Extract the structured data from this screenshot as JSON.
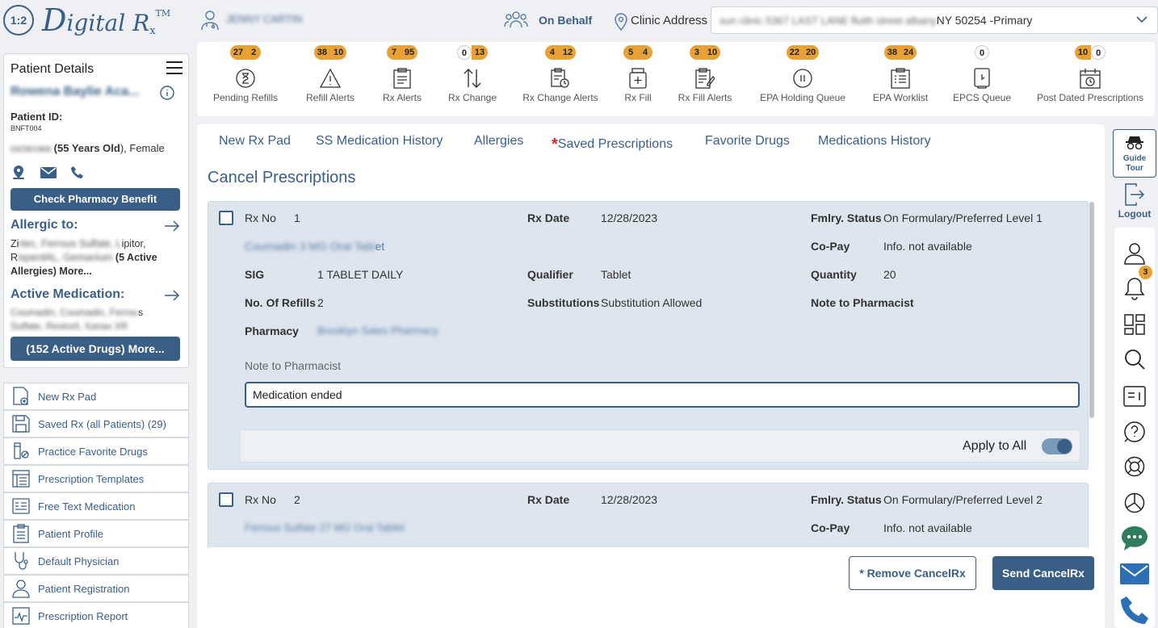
{
  "app": {
    "logo_badge": "1:2",
    "logo_d": "D",
    "logo_rest": "igital R",
    "logo_x": "x",
    "logo_tm": "TM"
  },
  "header": {
    "user_name": "JENNY CARTIN",
    "on_behalf": "On Behalf",
    "clinic_label": "Clinic Address",
    "clinic_value_blurred": "sun clinic 5367 LAST LANE fluith street albany",
    "clinic_value_suffix": " NY 50254 -Primary"
  },
  "patient": {
    "section_title": "Patient Details",
    "name": "Rowena Baylie Aca...",
    "id_label": "Patient ID:",
    "id_value": "BNFT004",
    "dob_blurred": "03/28/1968",
    "age": " (55 Years Old",
    "gender": "), Female",
    "check_benefit": "Check Pharmacy Benefit",
    "allergic_title": "Allergic to:",
    "allergy_line1_a": "Zi",
    "allergy_line1_blur": "rtec, Ferrous Sulfate, L",
    "allergy_line1_b": "ipitor,",
    "allergy_line2_a": "R",
    "allergy_line2_blur": "isperdAL, Gemanium",
    "allergy_count": " (5 Active",
    "allergy_line3": "Allergies) More...",
    "active_med_title": "Active Medication:",
    "med_line1_blur": "Coumadin, Coumadin, Ferrou",
    "med_line1_b": "s",
    "med_line2_blur": "Sulfate, Restoril, Xanax XR",
    "active_drugs_btn": "(152 Active Drugs) More..."
  },
  "left_menu": [
    {
      "label": "New Rx Pad",
      "icon": "new-rx-pad-icon"
    },
    {
      "label": "Saved Rx (all Patients) (29)",
      "icon": "save-icon"
    },
    {
      "label": "Practice Favorite Drugs",
      "icon": "pill-bottle-icon"
    },
    {
      "label": "Prescription Templates",
      "icon": "template-icon"
    },
    {
      "label": "Free Text Medication",
      "icon": "free-text-icon"
    },
    {
      "label": "Patient Profile",
      "icon": "profile-clipboard-icon"
    },
    {
      "label": "Default Physician",
      "icon": "stethoscope-icon"
    },
    {
      "label": "Patient Registration",
      "icon": "user-registration-icon"
    },
    {
      "label": "Prescription Report",
      "icon": "report-icon"
    }
  ],
  "queues": [
    {
      "label": "Pending Refills",
      "a": "27",
      "b": "2",
      "a_style": "o",
      "b_style": "o",
      "icon": "hourglass-icon"
    },
    {
      "label": "Refill Alerts",
      "a": "38",
      "b": "10",
      "a_style": "o",
      "b_style": "o",
      "icon": "warning-icon"
    },
    {
      "label": "Rx Alerts",
      "a": "7",
      "b": "95",
      "a_style": "o",
      "b_style": "o",
      "icon": "rx-document-icon"
    },
    {
      "label": "Rx Change",
      "a": "0",
      "b": "13",
      "a_style": "w",
      "b_style": "o",
      "icon": "swap-arrows-icon"
    },
    {
      "label": "Rx Change Alerts",
      "a": "4",
      "b": "12",
      "a_style": "o",
      "b_style": "o",
      "icon": "rx-change-alert-icon"
    },
    {
      "label": "Rx Fill",
      "a": "5",
      "b": "4",
      "a_style": "o",
      "b_style": "o",
      "icon": "medicine-bottle-icon"
    },
    {
      "label": "Rx Fill Alerts",
      "a": "3",
      "b": "10",
      "a_style": "o",
      "b_style": "o",
      "icon": "edit-document-icon"
    },
    {
      "label": "EPA Holding Queue",
      "a": "22",
      "b": "20",
      "a_style": "o",
      "b_style": "o",
      "icon": "pause-circle-icon"
    },
    {
      "label": "EPA Worklist",
      "a": "38",
      "b": "24",
      "a_style": "o",
      "b_style": "o",
      "icon": "clipboard-list-icon"
    },
    {
      "label": "EPCS Queue",
      "a": "0",
      "b": "",
      "a_style": "w",
      "b_style": "",
      "icon": "epcs-device-icon"
    },
    {
      "label": "Post Dated Prescriptions",
      "a": "10",
      "b": "0",
      "a_style": "o",
      "b_style": "w",
      "icon": "calendar-clock-icon"
    }
  ],
  "tabs": {
    "new_rx_pad": "New Rx Pad",
    "ss_med_history": "SS Medication History",
    "allergies": "Allergies",
    "saved_star": "*",
    "saved_prescriptions": "Saved Prescriptions",
    "favorite_drugs": "Favorite Drugs",
    "medications_history": "Medications History"
  },
  "main": {
    "page_title": "Cancel Prescriptions",
    "rx1": {
      "rx_no_label": "Rx No",
      "rx_no": "1",
      "rx_date_label": "Rx Date",
      "rx_date": "12/28/2023",
      "fmlry_label": "Fmlry. Status",
      "fmlry": "On Formulary/Preferred Level 1",
      "drug_blur": "Coumadin 3 MG Oral Tabl",
      "drug_tail": "et",
      "copay_label": "Co-Pay",
      "copay": "Info. not available",
      "sig_label": "SIG",
      "sig": "1 TABLET DAILY",
      "qualifier_label": "Qualifier",
      "qualifier": "Tablet",
      "quantity_label": "Quantity",
      "quantity": "20",
      "refills_label": "No. Of Refills",
      "refills": "2",
      "subs_label": "Substitutions",
      "subs": "Substitution Allowed",
      "note_label_right": "Note to Pharmacist",
      "pharmacy_label": "Pharmacy",
      "pharmacy_blur": "Brooklyn Sates Pharmacy",
      "note_field_label": "Note to Pharmacist",
      "note_value": "Medication ended",
      "apply_all": "Apply to All",
      "apply_all_on": true
    },
    "rx2": {
      "rx_no_label": "Rx No",
      "rx_no": "2",
      "rx_date_label": "Rx Date",
      "rx_date": "12/28/2023",
      "fmlry_label": "Fmlry. Status",
      "fmlry": "On Formulary/Preferred Level 2",
      "drug_blur": "Ferrous Sulfate 27 MG Oral Tablet",
      "copay_label": "Co-Pay",
      "copay": "Info. not available"
    },
    "remove_btn": "* Remove CancelRx",
    "send_btn": "Send CancelRx"
  },
  "right_sidebar": {
    "guide_tour_1": "Guide",
    "guide_tour_2": "Tour",
    "logout": "Logout",
    "notif_count": "3"
  },
  "colors": {
    "brand": "#3a5f86",
    "badge_orange": "#e8a134",
    "card_bg": "#dde5ee",
    "star_red": "#d9232d"
  }
}
